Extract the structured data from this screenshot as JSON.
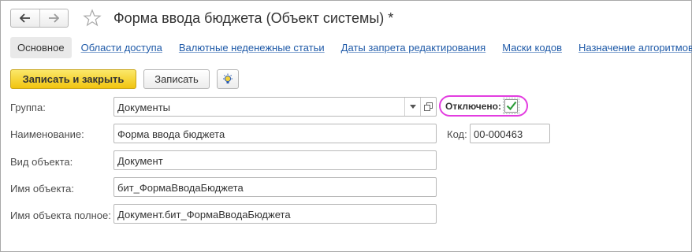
{
  "window": {
    "title": "Форма ввода бюджета (Объект системы) *",
    "nav": {
      "back_icon": "arrow-left-icon",
      "forward_icon": "arrow-right-icon"
    },
    "favorite_icon": "star-icon"
  },
  "tabs": [
    {
      "label": "Основное",
      "active": true
    },
    {
      "label": "Области доступа"
    },
    {
      "label": "Валютные неденежные статьи"
    },
    {
      "label": "Даты запрета редактирования"
    },
    {
      "label": "Маски кодов"
    },
    {
      "label": "Назначение алгоритмов"
    }
  ],
  "toolbar": {
    "save_close_label": "Записать и закрыть",
    "save_label": "Записать",
    "hint_icon": "lightbulb-icon"
  },
  "form": {
    "group": {
      "label": "Группа:",
      "value": "Документы"
    },
    "disabled": {
      "label": "Отключено:",
      "checked": true
    },
    "name": {
      "label": "Наименование:",
      "value": "Форма ввода бюджета"
    },
    "code": {
      "label": "Код:",
      "value": "00-000463"
    },
    "object_kind": {
      "label": "Вид объекта:",
      "value": "Документ"
    },
    "object_name": {
      "label": "Имя объекта:",
      "value": "бит_ФормаВводаБюджета"
    },
    "object_full_name": {
      "label": "Имя объекта полное:",
      "value": "Документ.бит_ФормаВводаБюджета"
    }
  },
  "colors": {
    "primary_button": "#f1c40f",
    "link": "#1f5aa8",
    "highlight_ring": "#e33de0",
    "checkmark": "#2e9e3a"
  }
}
